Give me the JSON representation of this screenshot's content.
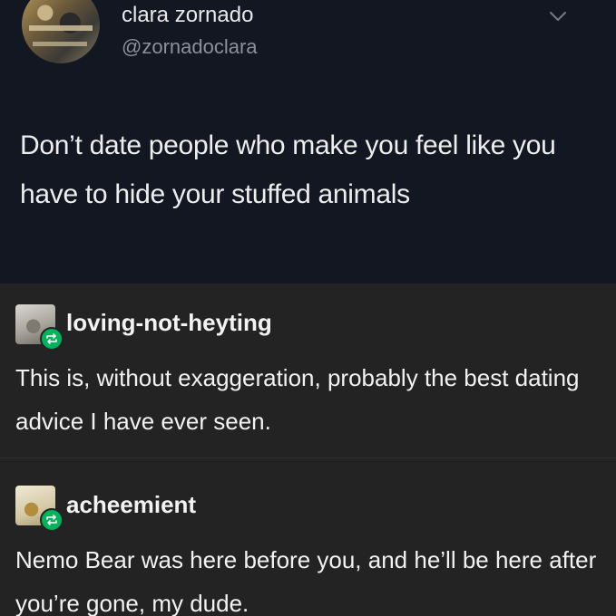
{
  "tweet": {
    "display_name": "clara zornado",
    "handle": "@zornadoclara",
    "text": "Don’t date people who make you feel like you have to hide your stuffed animals"
  },
  "reblogs": [
    {
      "username": "loving-not-heyting",
      "text": "This is, without exaggeration, probably the best dating advice I have ever seen."
    },
    {
      "username": "acheemient",
      "text": "Nemo Bear was here before you, and he’ll be here after you’re gone, my dude."
    }
  ],
  "colors": {
    "tweet_background": "#121722",
    "tumblr_background": "#232323",
    "reblog_badge": "#00b35c"
  },
  "icons": {
    "menu": "chevron-down-icon",
    "reblog": "reblog-icon"
  }
}
